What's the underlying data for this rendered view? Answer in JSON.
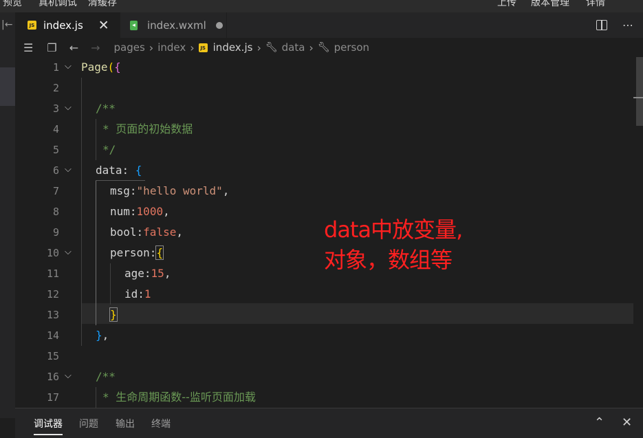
{
  "topbar": {
    "preview": "预览",
    "real_debug": "真机调试",
    "clear_cache": "清缓存",
    "upload": "上传",
    "version": "版本管理",
    "details": "详情"
  },
  "tabs": [
    {
      "label": "index.js",
      "icon": "js-file-icon",
      "active": true
    },
    {
      "label": "index.wxml",
      "icon": "wxml-file-icon",
      "active": false,
      "modified": true
    }
  ],
  "breadcrumbs": [
    "pages",
    "index",
    "index.js",
    "data",
    "person"
  ],
  "editor": {
    "lines": [
      {
        "n": "1"
      },
      {
        "n": "2"
      },
      {
        "n": "3"
      },
      {
        "n": "4"
      },
      {
        "n": "5"
      },
      {
        "n": "6"
      },
      {
        "n": "7"
      },
      {
        "n": "8"
      },
      {
        "n": "9"
      },
      {
        "n": "10"
      },
      {
        "n": "11"
      },
      {
        "n": "12"
      },
      {
        "n": "13"
      },
      {
        "n": "14"
      },
      {
        "n": "15"
      },
      {
        "n": "16"
      },
      {
        "n": "17"
      }
    ],
    "code": {
      "l1_fn": "Page",
      "l1_p": "(",
      "l1_b": "{",
      "l3": "/**",
      "l4_star": "* ",
      "l4_text": "页面的初始数据",
      "l5": "*/",
      "l6_key": "data",
      "l6_colon": ": ",
      "l6_b": "{",
      "l7_key": "msg",
      "l7_colon": ":",
      "l7_val": "\"hello world\"",
      "l7_comma": ",",
      "l8_key": "num",
      "l8_colon": ":",
      "l8_val": "1000",
      "l8_comma": ",",
      "l9_key": "bool",
      "l9_colon": ":",
      "l9_val": "false",
      "l9_comma": ",",
      "l10_key": "person",
      "l10_colon": ":",
      "l10_b": "{",
      "l11_key": "age",
      "l11_colon": ":",
      "l11_val": "15",
      "l11_comma": ",",
      "l12_key": "id",
      "l12_colon": ":",
      "l12_val": "1",
      "l13_b": "}",
      "l14_b": "}",
      "l14_comma": ",",
      "l16": "/**",
      "l17_star": "* ",
      "l17_text": "生命周期函数--监听页面加载"
    }
  },
  "annotation": {
    "line1": "data中放变量,",
    "line2": "对象，数组等"
  },
  "panel": {
    "tabs": [
      "调试器",
      "问题",
      "输出",
      "终端"
    ],
    "active": "调试器"
  }
}
